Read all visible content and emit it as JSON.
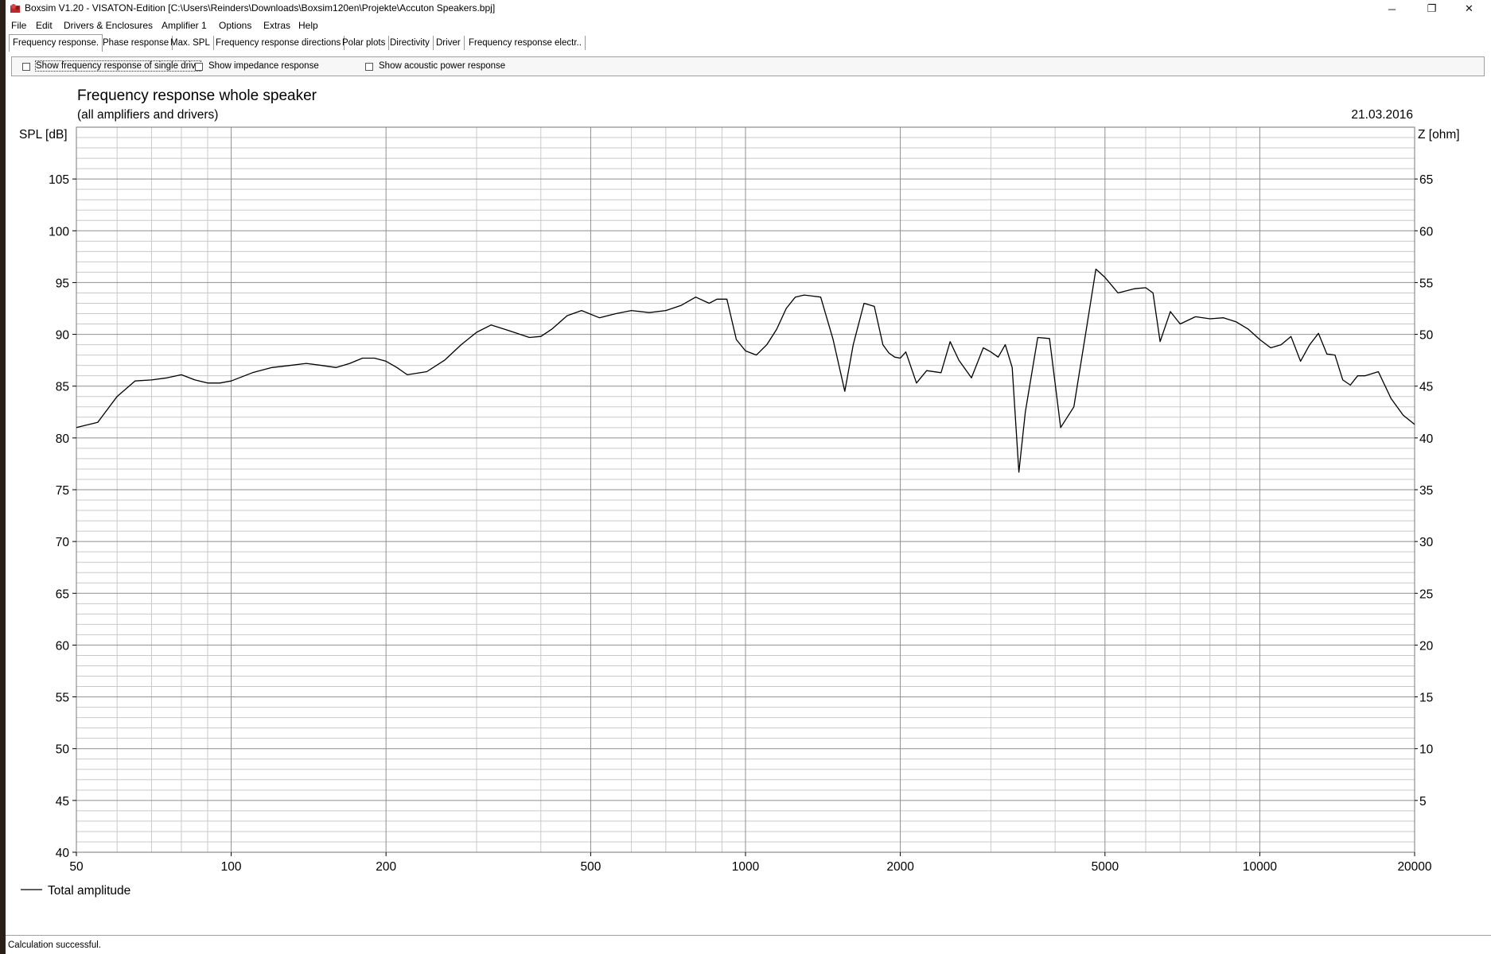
{
  "window": {
    "title": "Boxsim V1.20 - VISATON-Edition [C:\\Users\\Reinders\\Downloads\\Boxsim120en\\Projekte\\Accuton Speakers.bpj]",
    "minimize": "─",
    "maximize": "❐",
    "close": "✕"
  },
  "menu": [
    "File",
    "Edit",
    "Drivers & Enclosures",
    "Amplifier 1",
    "Options",
    "Extras",
    "Help"
  ],
  "tabs": [
    {
      "label": "Frequency response.",
      "active": true
    },
    {
      "label": "Phase response"
    },
    {
      "label": "Max. SPL"
    },
    {
      "label": "Frequency response directions"
    },
    {
      "label": "Polar plots"
    },
    {
      "label": "Directivity"
    },
    {
      "label": "Driver"
    },
    {
      "label": "Frequency response electr.."
    }
  ],
  "options": {
    "single_driver": {
      "label": "Show frequency response of single drive",
      "checked": false
    },
    "impedance": {
      "label": "Show impedance response",
      "checked": false
    },
    "acoustic_power": {
      "label": "Show acoustic power response",
      "checked": false
    }
  },
  "chart_data": {
    "type": "line",
    "title": "Frequency response whole speaker",
    "subtitle": "(all amplifiers and drivers)",
    "date": "21.03.2016",
    "ylabel": "SPL [dB]",
    "y2label": "Z [ohm]",
    "xscale": "log",
    "xlim": [
      50,
      20000
    ],
    "ylim": [
      40,
      110
    ],
    "y2lim": [
      0,
      70
    ],
    "xticks": [
      50,
      100,
      200,
      500,
      1000,
      2000,
      5000,
      10000,
      20000
    ],
    "yticks": [
      40,
      45,
      50,
      55,
      60,
      65,
      70,
      75,
      80,
      85,
      90,
      95,
      100,
      105
    ],
    "y2ticks": [
      5,
      10,
      15,
      20,
      25,
      30,
      35,
      40,
      45,
      50,
      55,
      60,
      65
    ],
    "grid": true,
    "legend_position": "bottom-left",
    "series": [
      {
        "name": "Total amplitude",
        "color": "#000000",
        "x": [
          50,
          55,
          60,
          65,
          70,
          75,
          80,
          85,
          90,
          95,
          100,
          110,
          120,
          130,
          140,
          150,
          160,
          170,
          180,
          190,
          200,
          210,
          220,
          240,
          260,
          280,
          300,
          320,
          350,
          380,
          400,
          420,
          450,
          480,
          520,
          560,
          600,
          650,
          700,
          750,
          800,
          850,
          880,
          920,
          960,
          1000,
          1050,
          1100,
          1150,
          1200,
          1250,
          1300,
          1400,
          1480,
          1560,
          1620,
          1700,
          1780,
          1850,
          1900,
          1950,
          2000,
          2050,
          2150,
          2250,
          2400,
          2500,
          2600,
          2750,
          2900,
          3000,
          3100,
          3200,
          3300,
          3400,
          3500,
          3700,
          3900,
          4100,
          4350,
          4600,
          4800,
          5000,
          5300,
          5700,
          6000,
          6200,
          6400,
          6700,
          7000,
          7500,
          8000,
          8500,
          9000,
          9500,
          10000,
          10500,
          11000,
          11500,
          12000,
          12500,
          13000,
          13500,
          14000,
          14500,
          15000,
          15500,
          16000,
          16500,
          17000,
          18000,
          19000,
          20000
        ],
        "values": [
          81.0,
          81.5,
          84.0,
          85.5,
          85.6,
          85.8,
          86.1,
          85.6,
          85.3,
          85.3,
          85.5,
          86.3,
          86.8,
          87.0,
          87.2,
          87.0,
          86.8,
          87.2,
          87.7,
          87.7,
          87.4,
          86.8,
          86.1,
          86.4,
          87.5,
          89.0,
          90.2,
          90.9,
          90.3,
          89.7,
          89.8,
          90.5,
          91.8,
          92.3,
          91.6,
          92.0,
          92.3,
          92.1,
          92.3,
          92.8,
          93.6,
          93.0,
          93.4,
          93.4,
          89.5,
          88.4,
          88.0,
          89.0,
          90.5,
          92.5,
          93.6,
          93.8,
          93.6,
          89.5,
          84.5,
          89.0,
          93.0,
          92.7,
          89.0,
          88.2,
          87.8,
          87.7,
          88.3,
          85.3,
          86.5,
          86.3,
          89.3,
          87.5,
          85.8,
          88.7,
          88.3,
          87.8,
          89.0,
          86.8,
          76.7,
          82.5,
          89.7,
          89.6,
          81.0,
          83.0,
          90.5,
          96.3,
          95.5,
          94.0,
          94.4,
          94.5,
          94.0,
          89.3,
          92.2,
          91.0,
          91.7,
          91.5,
          91.6,
          91.2,
          90.5,
          89.5,
          88.7,
          89.0,
          89.8,
          87.4,
          89.0,
          90.1,
          88.1,
          88.0,
          85.6,
          85.1,
          86.0,
          86.0,
          86.2,
          86.4,
          83.8,
          82.2,
          81.3
        ]
      }
    ]
  },
  "status": "Calculation successful."
}
